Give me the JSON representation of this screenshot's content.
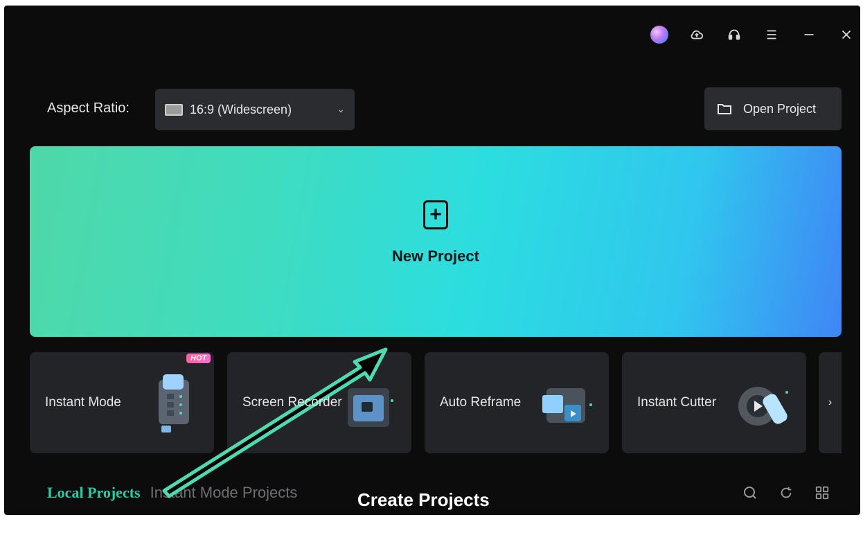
{
  "titlebar": {
    "icons": [
      "avatar",
      "cloud-upload-icon",
      "support-headset-icon",
      "menu-icon",
      "minimize-icon",
      "close-icon"
    ]
  },
  "aspect": {
    "label": "Aspect Ratio:",
    "value": "16:9 (Widescreen)"
  },
  "open_project": {
    "label": "Open Project"
  },
  "new_project": {
    "label": "New Project"
  },
  "cards": [
    {
      "label": "Instant Mode",
      "badge": "HOT"
    },
    {
      "label": "Screen Recorder"
    },
    {
      "label": "Auto Reframe"
    },
    {
      "label": "Instant Cutter"
    }
  ],
  "tabs": {
    "local": "Local Projects",
    "instant": "Instant Mode Projects"
  },
  "caption": "Create Projects",
  "colors": {
    "accent": "#2fc9a6",
    "arrow": "#4fd9b0",
    "background": "#0c0c0d",
    "panel": "#2b2c30"
  }
}
